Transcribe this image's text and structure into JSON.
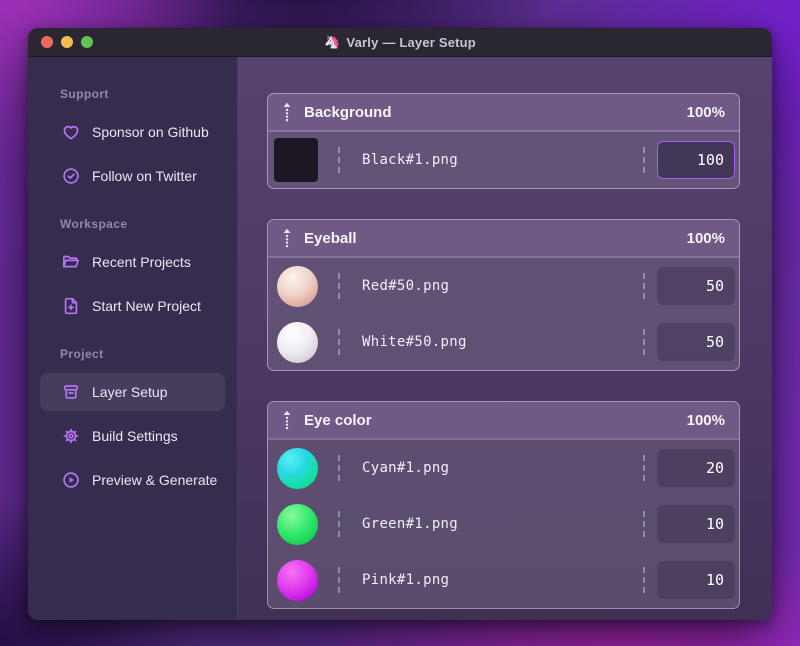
{
  "window": {
    "app_icon": "🦄",
    "title": "Varly — Layer Setup"
  },
  "titlebar_buttons": {
    "close": "close",
    "minimize": "minimize",
    "zoom": "zoom"
  },
  "sidebar": {
    "sections": [
      {
        "label": "Support",
        "items": [
          {
            "icon": "heart-icon",
            "label": "Sponsor on Github",
            "active": false
          },
          {
            "icon": "verified-badge-icon",
            "label": "Follow on Twitter",
            "active": false
          }
        ]
      },
      {
        "label": "Workspace",
        "items": [
          {
            "icon": "folder-open-icon",
            "label": "Recent Projects",
            "active": false
          },
          {
            "icon": "file-plus-icon",
            "label": "Start New Project",
            "active": false
          }
        ]
      },
      {
        "label": "Project",
        "items": [
          {
            "icon": "archive-box-icon",
            "label": "Layer Setup",
            "active": true
          },
          {
            "icon": "gear-icon",
            "label": "Build Settings",
            "active": false
          },
          {
            "icon": "play-circle-icon",
            "label": "Preview & Generate",
            "active": false
          }
        ]
      }
    ]
  },
  "layers": {
    "groups": [
      {
        "name": "Background",
        "weight": "100%",
        "items": [
          {
            "thumb": "black-square",
            "file": "Black#1.png",
            "value": "100",
            "focused": true
          }
        ]
      },
      {
        "name": "Eyeball",
        "weight": "100%",
        "items": [
          {
            "thumb": "red-sphere",
            "file": "Red#50.png",
            "value": "50",
            "focused": false
          },
          {
            "thumb": "white-sphere",
            "file": "White#50.png",
            "value": "50",
            "focused": false
          }
        ]
      },
      {
        "name": "Eye color",
        "weight": "100%",
        "items": [
          {
            "thumb": "cyan-sphere",
            "file": "Cyan#1.png",
            "value": "20",
            "focused": false
          },
          {
            "thumb": "green-sphere",
            "file": "Green#1.png",
            "value": "10",
            "focused": false
          },
          {
            "thumb": "pink-sphere",
            "file": "Pink#1.png",
            "value": "10",
            "focused": false
          }
        ]
      }
    ]
  },
  "colors": {
    "accent": "#a85bf5",
    "sidebar_icon": "#b673f3",
    "titlebar_bg": "#2a2733",
    "sidebar_bg": "#362d4e",
    "group_header_bg": "#6e5a85",
    "traffic_close": "#ee6a5f",
    "traffic_minimize": "#f5bd4f",
    "traffic_zoom": "#61c354"
  }
}
